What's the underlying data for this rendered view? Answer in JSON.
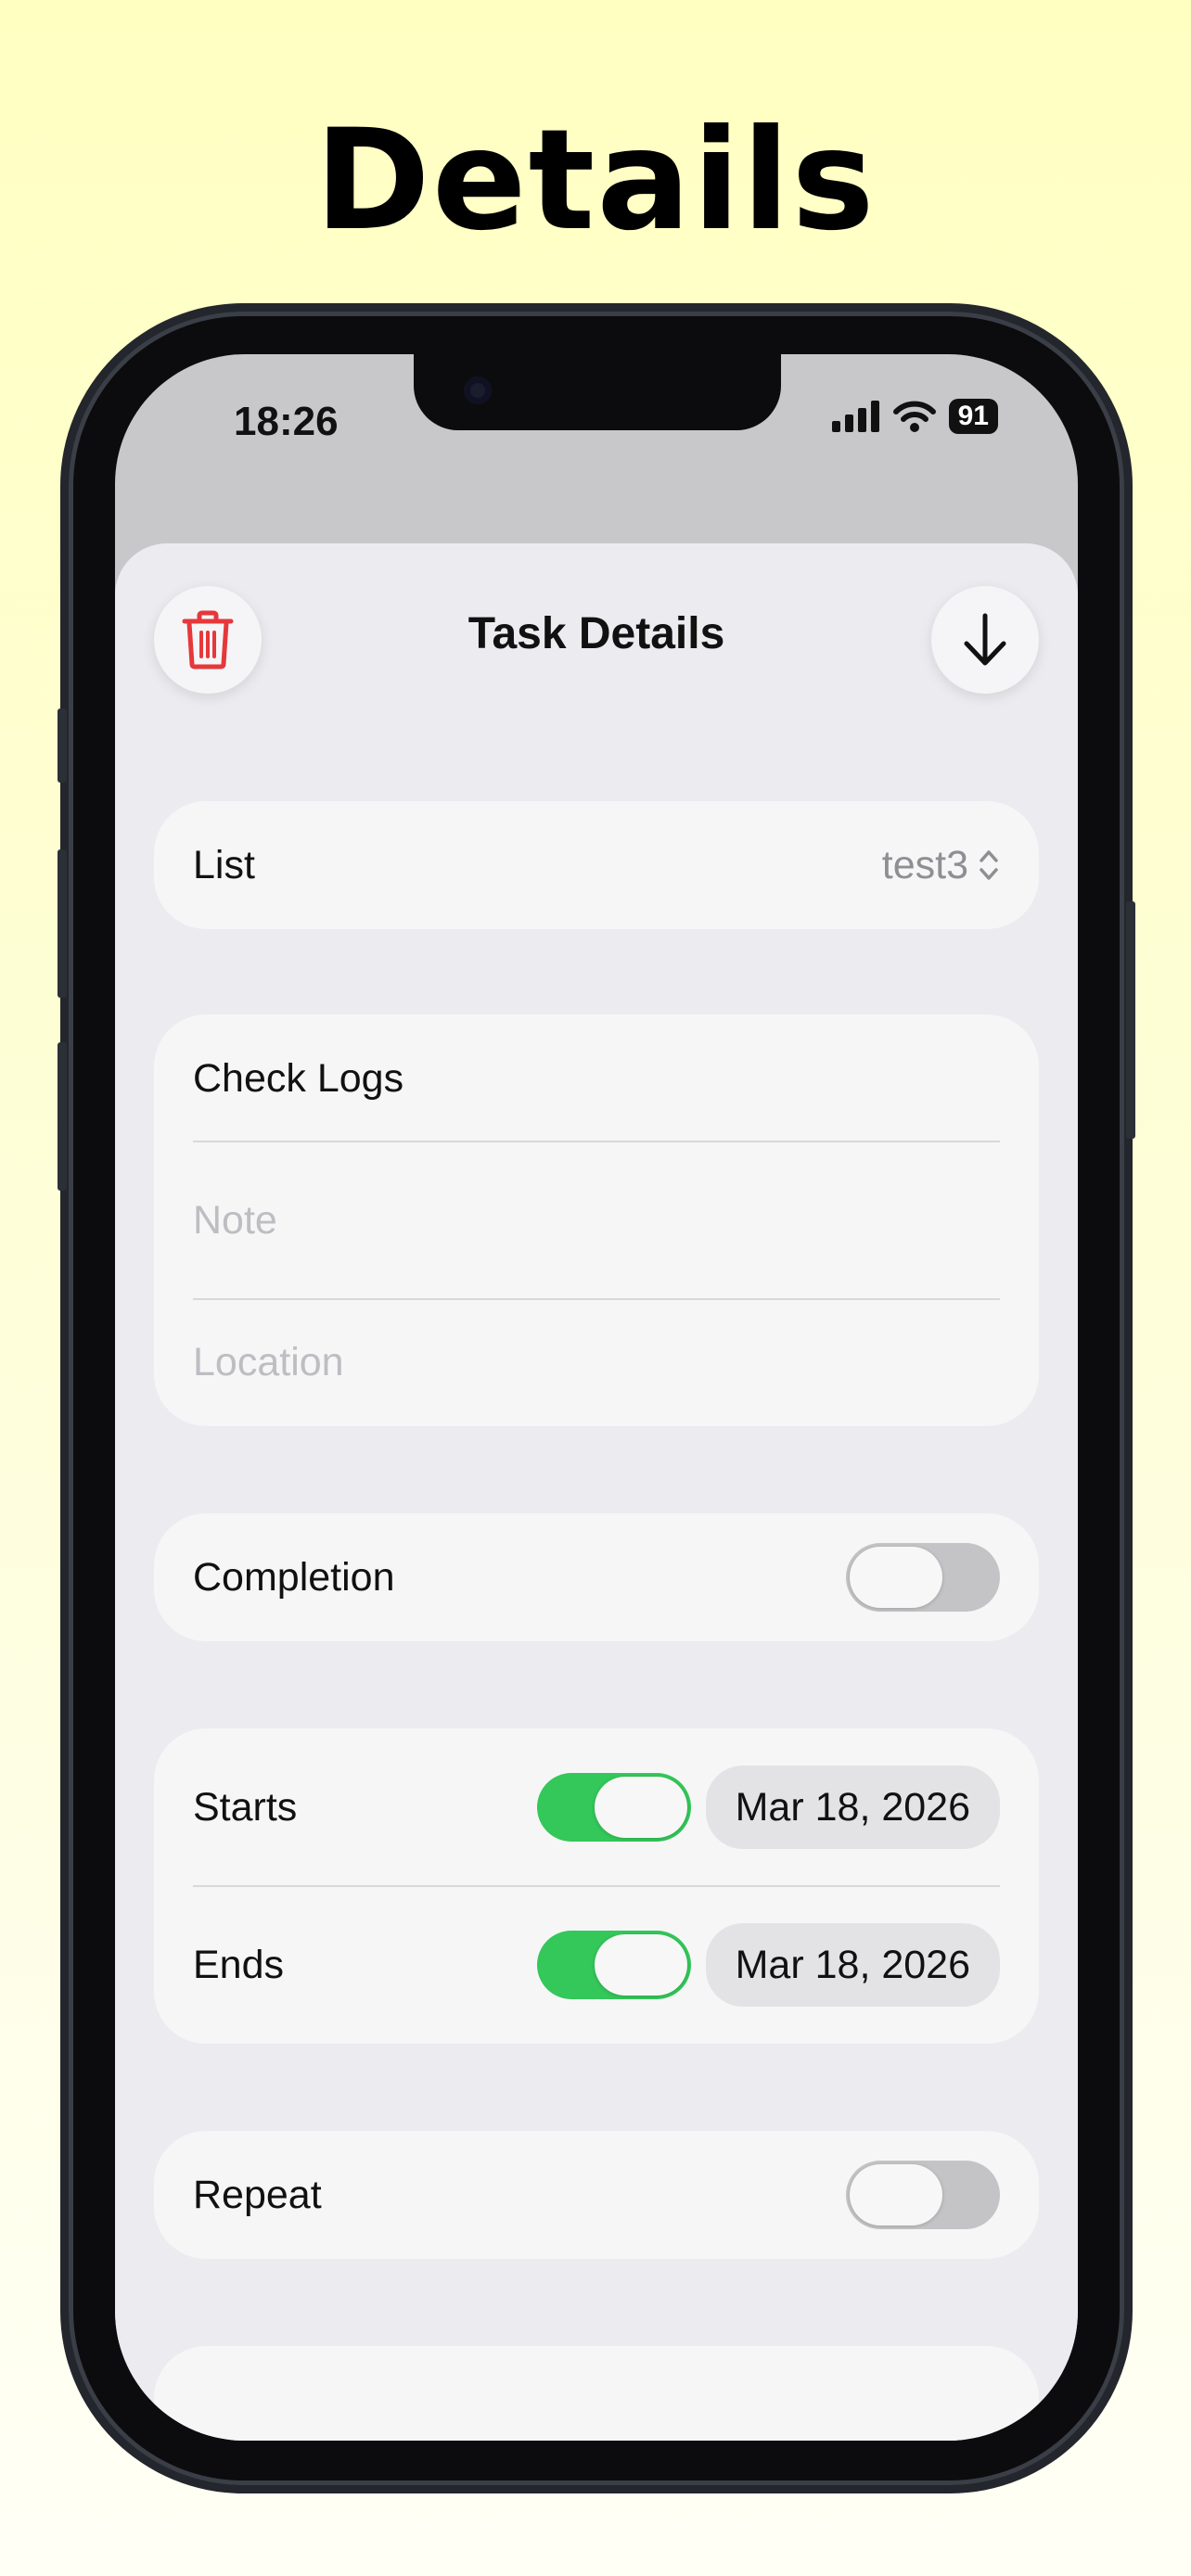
{
  "headline": "Details",
  "status_bar": {
    "time": "18:26",
    "battery": "91"
  },
  "sheet": {
    "title": "Task Details",
    "delete_icon": "trash-icon",
    "save_icon": "arrow-down-icon"
  },
  "list_row": {
    "label": "List",
    "value": "test3"
  },
  "task": {
    "title": "Check Logs",
    "note_placeholder": "Note",
    "location_placeholder": "Location"
  },
  "completion": {
    "label": "Completion",
    "enabled": false
  },
  "dates": {
    "starts": {
      "label": "Starts",
      "enabled": true,
      "value": "Mar 18, 2026"
    },
    "ends": {
      "label": "Ends",
      "enabled": true,
      "value": "Mar 18, 2026"
    }
  },
  "repeat": {
    "label": "Repeat",
    "enabled": false
  },
  "colors": {
    "accent_green": "#34c759",
    "destructive_red": "#e5383b"
  }
}
